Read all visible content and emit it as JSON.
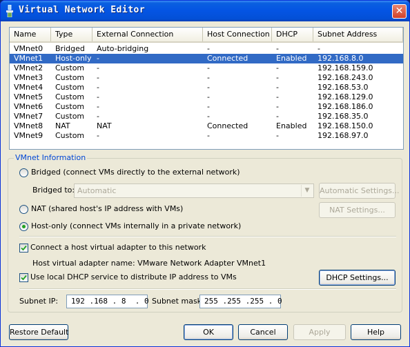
{
  "window": {
    "title": "Virtual Network Editor",
    "close_glyph": "✕"
  },
  "table": {
    "columns": [
      "Name",
      "Type",
      "External Connection",
      "Host Connection",
      "DHCP",
      "Subnet Address"
    ],
    "rows": [
      [
        "VMnet0",
        "Bridged",
        "Auto-bridging",
        "-",
        "-",
        "-"
      ],
      [
        "VMnet1",
        "Host-only",
        "-",
        "Connected",
        "Enabled",
        "192.168.8.0"
      ],
      [
        "VMnet2",
        "Custom",
        "-",
        "-",
        "-",
        "192.168.159.0"
      ],
      [
        "VMnet3",
        "Custom",
        "-",
        "-",
        "-",
        "192.168.243.0"
      ],
      [
        "VMnet4",
        "Custom",
        "-",
        "-",
        "-",
        "192.168.53.0"
      ],
      [
        "VMnet5",
        "Custom",
        "-",
        "-",
        "-",
        "192.168.129.0"
      ],
      [
        "VMnet6",
        "Custom",
        "-",
        "-",
        "-",
        "192.168.186.0"
      ],
      [
        "VMnet7",
        "Custom",
        "-",
        "-",
        "-",
        "192.168.35.0"
      ],
      [
        "VMnet8",
        "NAT",
        "NAT",
        "Connected",
        "Enabled",
        "192.168.150.0"
      ],
      [
        "VMnet9",
        "Custom",
        "-",
        "-",
        "-",
        "192.168.97.0"
      ]
    ]
  },
  "info": {
    "group_title": "VMnet Information",
    "bridged_label": "Bridged (connect VMs directly to the external network)",
    "bridged_to_label": "Bridged to:",
    "bridged_to_value": "Automatic",
    "automatic_settings_button": "Automatic Settings...",
    "nat_label": "NAT (shared host's IP address with VMs)",
    "nat_settings_button": "NAT Settings...",
    "hostonly_label": "Host-only (connect VMs internally in a private network)",
    "connect_adapter_label": "Connect a host virtual adapter to this network",
    "adapter_name_label": "Host virtual adapter name: VMware Network Adapter VMnet1",
    "dhcp_label": "Use local DHCP service to distribute IP address to VMs",
    "dhcp_settings_button": "DHCP Settings...",
    "subnet_ip_label": "Subnet IP:",
    "subnet_ip_value": "192 .168 . 8  . 0",
    "subnet_mask_label": "Subnet mask:",
    "subnet_mask_value": "255 .255 .255 . 0"
  },
  "buttons": {
    "restore_default": "Restore Default",
    "ok": "OK",
    "cancel": "Cancel",
    "apply": "Apply",
    "help": "Help"
  },
  "colors": {
    "selection": "#316ac5",
    "titlebar": "#0454e3",
    "group_title": "#0046d5"
  }
}
